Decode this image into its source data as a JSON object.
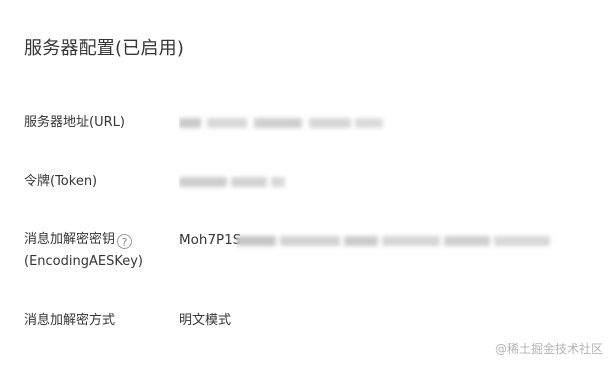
{
  "page": {
    "title": "服务器配置(已启用)"
  },
  "fields": {
    "server_url_label": "服务器地址(URL)",
    "token_label": "令牌(Token)",
    "aes_key_label_line1": "消息加解密密钥",
    "aes_key_label_line2": "(EncodingAESKey)",
    "aes_key_visible_prefix": "Moh7P1S",
    "encryption_mode_label": "消息加解密方式",
    "encryption_mode_value": "明文模式"
  },
  "icons": {
    "help": "question-circle-icon"
  },
  "watermark": {
    "text": "@稀土掘金技术社区"
  }
}
